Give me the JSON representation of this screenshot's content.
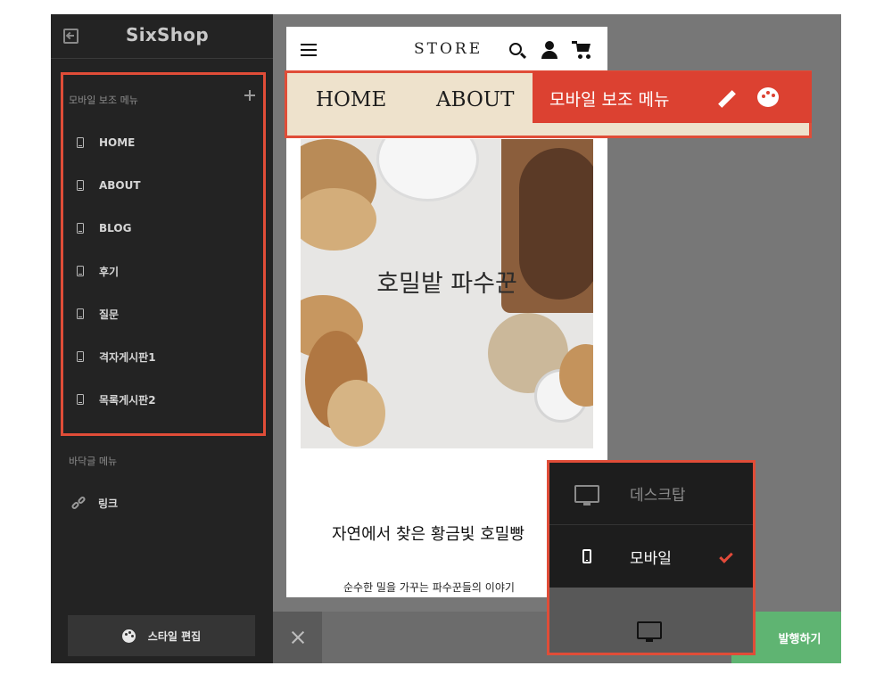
{
  "app": {
    "logo": "SixShop"
  },
  "sidebar": {
    "sub_menu_title": "모바일 보조 메뉴",
    "sub_menu_items": [
      {
        "label": "HOME"
      },
      {
        "label": "ABOUT"
      },
      {
        "label": "BLOG"
      },
      {
        "label": "후기"
      },
      {
        "label": "질문"
      },
      {
        "label": "격자게시판1"
      },
      {
        "label": "목록게시판2"
      }
    ],
    "footer_menu_title": "바닥글 메뉴",
    "footer_menu_items": [
      {
        "label": "링크"
      }
    ],
    "style_button": "스타일 편집"
  },
  "preview": {
    "store_name": "STORE",
    "nav_links": [
      "HOME",
      "ABOUT"
    ],
    "hero_title": "호밀밭 파수꾼",
    "tagline": "자연에서 찾은 황금빛 호밀빵",
    "subtitle": "순수한 밀을 가꾸는 파수꾼들의 이야기"
  },
  "tooltip": {
    "label": "모바일 보조 메뉴"
  },
  "device_menu": {
    "options": [
      {
        "label": "데스크탑",
        "selected": false
      },
      {
        "label": "모바일",
        "selected": true
      }
    ]
  },
  "bottom_bar": {
    "publish": "발행하기"
  },
  "colors": {
    "highlight": "#e04d38",
    "publish": "#5fb472",
    "nav_bg": "#eee2cc"
  }
}
